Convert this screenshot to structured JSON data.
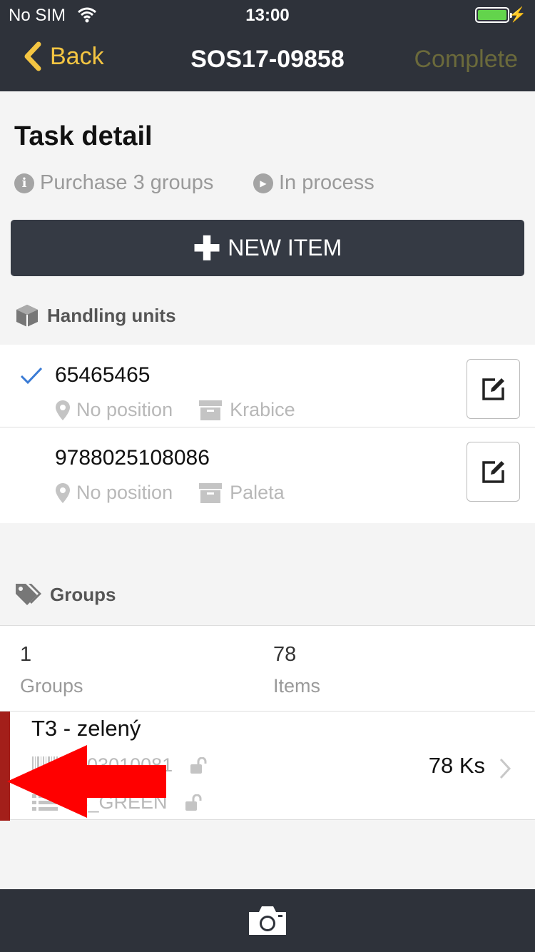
{
  "status_bar": {
    "carrier": "No SIM",
    "time": "13:00"
  },
  "nav": {
    "back_label": "Back",
    "title": "SOS17-09858",
    "complete_label": "Complete"
  },
  "task": {
    "heading": "Task detail",
    "type": "Purchase 3 groups",
    "state": "In process",
    "new_item_label": "NEW ITEM"
  },
  "handling_units": {
    "header": "Handling units",
    "items": [
      {
        "code": "65465465",
        "position": "No position",
        "kind": "Krabice",
        "checked": true
      },
      {
        "code": "9788025108086",
        "position": "No position",
        "kind": "Paleta",
        "checked": false
      }
    ]
  },
  "groups": {
    "header": "Groups",
    "count_value": "1",
    "count_label": "Groups",
    "items_value": "78",
    "items_label": "Items",
    "rows": [
      {
        "name": "T3 - zelený",
        "barcode": "5403010081",
        "code": "T3_GREEN",
        "quantity": "78 Ks",
        "bar_color": "#a31f1a"
      }
    ]
  },
  "colors": {
    "nav_bg": "#2e323a",
    "accent": "#f4c542",
    "annotation_arrow": "#ff0000"
  },
  "icons": [
    "back-chevron-icon",
    "info-icon",
    "play-icon",
    "plus-icon",
    "cube-icon",
    "checkmark-icon",
    "location-pin-icon",
    "archive-box-icon",
    "edit-icon",
    "tags-icon",
    "barcode-icon",
    "list-icon",
    "unlock-icon",
    "chevron-right-icon",
    "camera-icon"
  ]
}
